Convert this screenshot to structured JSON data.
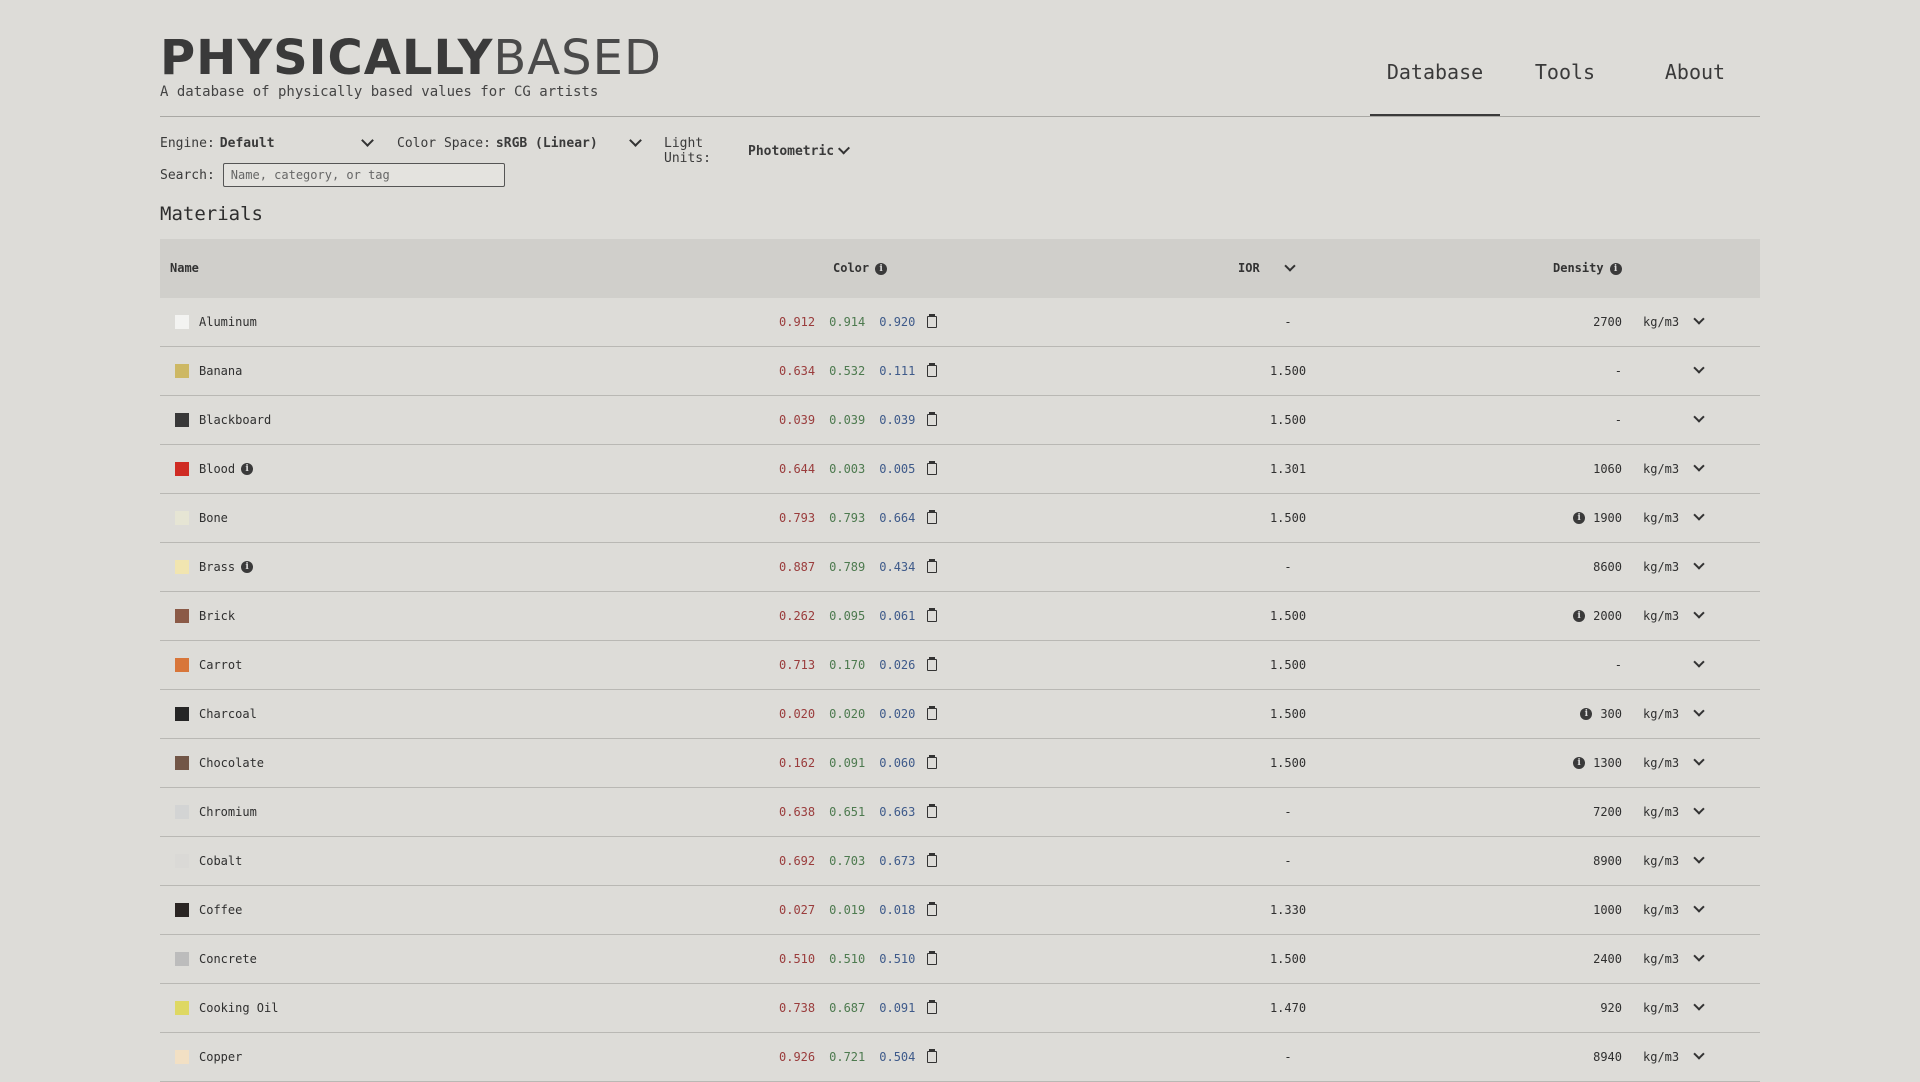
{
  "header": {
    "logo_bold": "PHYSICALLY",
    "logo_light": "BASED",
    "tagline": "A database of physically based values for CG artists"
  },
  "nav": [
    {
      "label": "Database",
      "active": true
    },
    {
      "label": "Tools",
      "active": false
    },
    {
      "label": "About",
      "active": false
    }
  ],
  "controls": {
    "engine_label": "Engine:",
    "engine_value": "Default",
    "colorspace_label": "Color Space:",
    "colorspace_value": "sRGB (Linear)",
    "lightunits_label": "Light Units:",
    "lightunits_value": "Photometric",
    "search_label": "Search:",
    "search_placeholder": "Name, category, or tag"
  },
  "section_title": "Materials",
  "columns": {
    "name": "Name",
    "color": "Color",
    "ior": "IOR",
    "density": "Density"
  },
  "materials": [
    {
      "name": "Aluminum",
      "swatch": "#f3f3f1",
      "info": false,
      "r": "0.912",
      "g": "0.914",
      "b": "0.920",
      "ior": "-",
      "density_info": false,
      "density": "2700",
      "unit": "kg/m3"
    },
    {
      "name": "Banana",
      "swatch": "#cdb864",
      "info": false,
      "r": "0.634",
      "g": "0.532",
      "b": "0.111",
      "ior": "1.500",
      "density_info": false,
      "density": "-",
      "unit": ""
    },
    {
      "name": "Blackboard",
      "swatch": "#383838",
      "info": false,
      "r": "0.039",
      "g": "0.039",
      "b": "0.039",
      "ior": "1.500",
      "density_info": false,
      "density": "-",
      "unit": ""
    },
    {
      "name": "Blood",
      "swatch": "#cf2b23",
      "info": true,
      "r": "0.644",
      "g": "0.003",
      "b": "0.005",
      "ior": "1.301",
      "density_info": false,
      "density": "1060",
      "unit": "kg/m3"
    },
    {
      "name": "Bone",
      "swatch": "#e6e5d4",
      "info": false,
      "r": "0.793",
      "g": "0.793",
      "b": "0.664",
      "ior": "1.500",
      "density_info": true,
      "density": "1900",
      "unit": "kg/m3"
    },
    {
      "name": "Brass",
      "swatch": "#f1e5b0",
      "info": true,
      "r": "0.887",
      "g": "0.789",
      "b": "0.434",
      "ior": "-",
      "density_info": false,
      "density": "8600",
      "unit": "kg/m3"
    },
    {
      "name": "Brick",
      "swatch": "#8b5a47",
      "info": false,
      "r": "0.262",
      "g": "0.095",
      "b": "0.061",
      "ior": "1.500",
      "density_info": true,
      "density": "2000",
      "unit": "kg/m3"
    },
    {
      "name": "Carrot",
      "swatch": "#d8763a",
      "info": false,
      "r": "0.713",
      "g": "0.170",
      "b": "0.026",
      "ior": "1.500",
      "density_info": false,
      "density": "-",
      "unit": ""
    },
    {
      "name": "Charcoal",
      "swatch": "#252525",
      "info": false,
      "r": "0.020",
      "g": "0.020",
      "b": "0.020",
      "ior": "1.500",
      "density_info": true,
      "density": "300",
      "unit": "kg/m3"
    },
    {
      "name": "Chocolate",
      "swatch": "#725647",
      "info": false,
      "r": "0.162",
      "g": "0.091",
      "b": "0.060",
      "ior": "1.500",
      "density_info": true,
      "density": "1300",
      "unit": "kg/m3"
    },
    {
      "name": "Chromium",
      "swatch": "#d3d4d4",
      "info": false,
      "r": "0.638",
      "g": "0.651",
      "b": "0.663",
      "ior": "-",
      "density_info": false,
      "density": "7200",
      "unit": "kg/m3"
    },
    {
      "name": "Cobalt",
      "swatch": "#dad9d6",
      "info": false,
      "r": "0.692",
      "g": "0.703",
      "b": "0.673",
      "ior": "-",
      "density_info": false,
      "density": "8900",
      "unit": "kg/m3"
    },
    {
      "name": "Coffee",
      "swatch": "#2a2523",
      "info": false,
      "r": "0.027",
      "g": "0.019",
      "b": "0.018",
      "ior": "1.330",
      "density_info": false,
      "density": "1000",
      "unit": "kg/m3"
    },
    {
      "name": "Concrete",
      "swatch": "#bcbcbc",
      "info": false,
      "r": "0.510",
      "g": "0.510",
      "b": "0.510",
      "ior": "1.500",
      "density_info": false,
      "density": "2400",
      "unit": "kg/m3"
    },
    {
      "name": "Cooking Oil",
      "swatch": "#ded863",
      "info": false,
      "r": "0.738",
      "g": "0.687",
      "b": "0.091",
      "ior": "1.470",
      "density_info": false,
      "density": "920",
      "unit": "kg/m3"
    },
    {
      "name": "Copper",
      "swatch": "#f2e0c4",
      "info": false,
      "r": "0.926",
      "g": "0.721",
      "b": "0.504",
      "ior": "-",
      "density_info": false,
      "density": "8940",
      "unit": "kg/m3"
    }
  ]
}
